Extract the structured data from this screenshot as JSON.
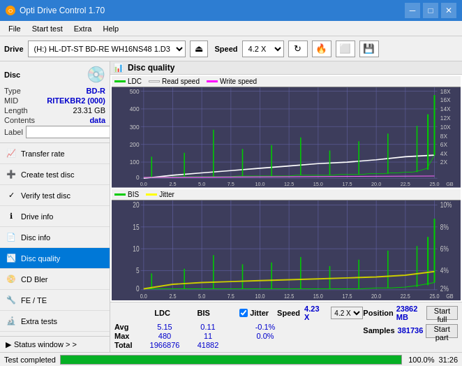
{
  "titleBar": {
    "title": "Opti Drive Control 1.70",
    "minBtn": "─",
    "maxBtn": "□",
    "closeBtn": "✕"
  },
  "menuBar": {
    "items": [
      "File",
      "Start test",
      "Extra",
      "Help"
    ]
  },
  "toolbar": {
    "driveLabel": "Drive",
    "driveOption": "(H:)  HL-DT-ST BD-RE  WH16NS48 1.D3",
    "speedLabel": "Speed",
    "speedOption": "4.2 X"
  },
  "disc": {
    "header": "Disc",
    "typeLabel": "Type",
    "typeVal": "BD-R",
    "midLabel": "MID",
    "midVal": "RITEKBR2 (000)",
    "lengthLabel": "Length",
    "lengthVal": "23.31 GB",
    "contentsLabel": "Contents",
    "contentsVal": "data",
    "labelLabel": "Label"
  },
  "navItems": [
    {
      "id": "transfer-rate",
      "label": "Transfer rate"
    },
    {
      "id": "create-test-disc",
      "label": "Create test disc"
    },
    {
      "id": "verify-test-disc",
      "label": "Verify test disc"
    },
    {
      "id": "drive-info",
      "label": "Drive info"
    },
    {
      "id": "disc-info",
      "label": "Disc info"
    },
    {
      "id": "disc-quality",
      "label": "Disc quality",
      "active": true
    },
    {
      "id": "cd-bler",
      "label": "CD Bler"
    },
    {
      "id": "fe-te",
      "label": "FE / TE"
    },
    {
      "id": "extra-tests",
      "label": "Extra tests"
    }
  ],
  "statusWindow": {
    "label": "Status window > >"
  },
  "chartTitle": "Disc quality",
  "topChart": {
    "legend": [
      {
        "label": "LDC",
        "color": "#00cc00"
      },
      {
        "label": "Read speed",
        "color": "#ffffff"
      },
      {
        "label": "Write speed",
        "color": "#ff00ff"
      }
    ],
    "yMax": 500,
    "yLabels": [
      "500",
      "400",
      "300",
      "200",
      "100",
      "0"
    ],
    "yRightLabels": [
      "18X",
      "16X",
      "14X",
      "12X",
      "10X",
      "8X",
      "6X",
      "4X",
      "2X"
    ],
    "xLabels": [
      "0.0",
      "2.5",
      "5.0",
      "7.5",
      "10.0",
      "12.5",
      "15.0",
      "17.5",
      "20.0",
      "22.5",
      "25.0"
    ],
    "xUnit": "GB"
  },
  "bottomChart": {
    "legend": [
      {
        "label": "BIS",
        "color": "#00cc00"
      },
      {
        "label": "Jitter",
        "color": "#ffff00"
      }
    ],
    "yMax": 20,
    "yLabels": [
      "20",
      "15",
      "10",
      "5",
      "0"
    ],
    "yRightLabels": [
      "10%",
      "8%",
      "6%",
      "4%",
      "2%"
    ],
    "xLabels": [
      "0.0",
      "2.5",
      "5.0",
      "7.5",
      "10.0",
      "12.5",
      "15.0",
      "17.5",
      "20.0",
      "22.5",
      "25.0"
    ],
    "xUnit": "GB"
  },
  "stats": {
    "headers": [
      "LDC",
      "BIS",
      "",
      "Jitter",
      "Speed"
    ],
    "jitterLabel": "Jitter",
    "speedLabel": "Speed",
    "speedVal": "4.23 X",
    "speedSelectVal": "4.2 X",
    "avgLabel": "Avg",
    "avgLdc": "5.15",
    "avgBis": "0.11",
    "avgJitter": "-0.1%",
    "maxLabel": "Max",
    "maxLdc": "480",
    "maxBis": "11",
    "maxJitter": "0.0%",
    "totalLabel": "Total",
    "totalLdc": "1966876",
    "totalBis": "41882",
    "positionLabel": "Position",
    "positionVal": "23862 MB",
    "samplesLabel": "Samples",
    "samplesVal": "381736",
    "startFullBtn": "Start full",
    "startPartBtn": "Start part"
  },
  "progressBar": {
    "percentage": 100,
    "percentText": "100.0%",
    "time": "31:26"
  },
  "statusBar": {
    "text": "Test completed"
  },
  "icons": {
    "disc": "💿",
    "settings": "⚙",
    "eject": "⏏",
    "refresh": "↻",
    "burn": "🔥",
    "save": "💾",
    "chartIcon": "📊",
    "transferRate": "📈",
    "createDisc": "➕",
    "verifyDisc": "✓",
    "driveInfo": "ℹ",
    "discInfo": "📄",
    "discQuality": "📉",
    "cdBler": "📀",
    "feTE": "🔧",
    "extraTests": "🔬",
    "statusArrow": "▶"
  }
}
